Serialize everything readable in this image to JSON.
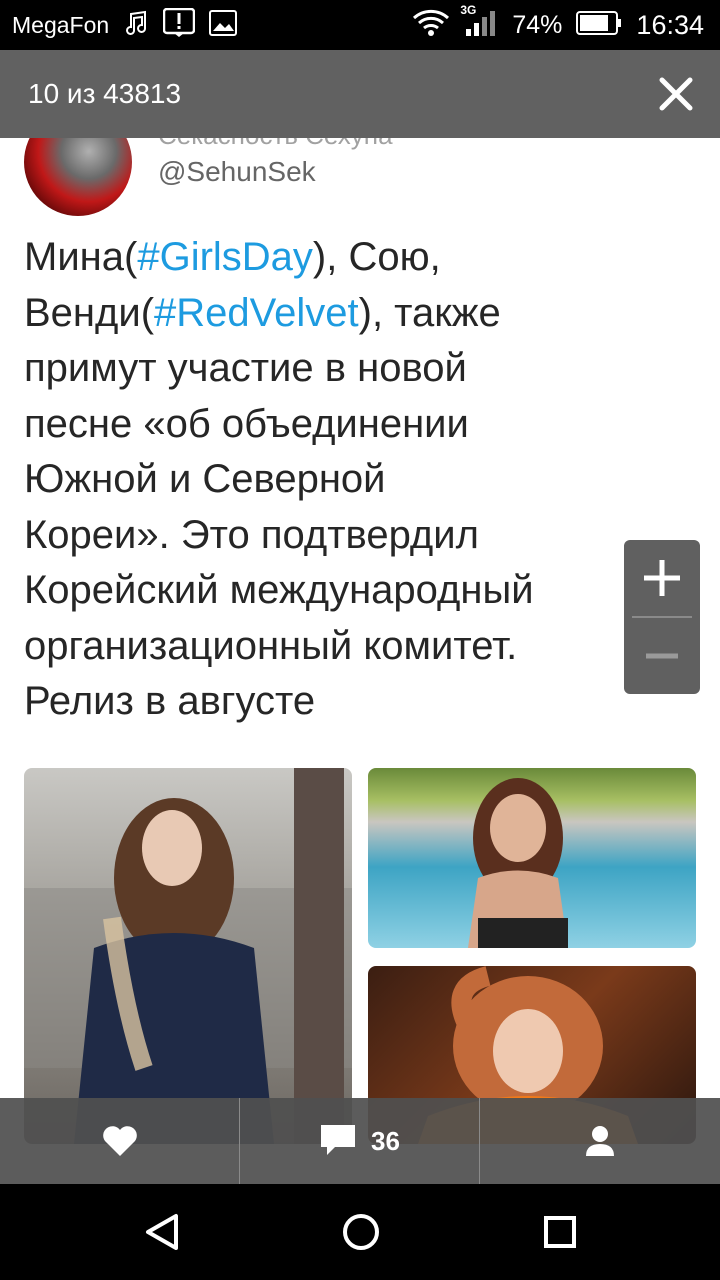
{
  "status_bar": {
    "carrier": "MegaFon",
    "network": "3G",
    "battery": "74%",
    "time": "16:34",
    "icons": [
      "music-note-icon",
      "alert-icon",
      "image-icon",
      "wifi-icon",
      "signal-icon",
      "battery-icon"
    ]
  },
  "viewer": {
    "counter": "10 из 43813",
    "close_icon": "close-icon"
  },
  "post": {
    "handle_top": "Секасность Сехуна",
    "handle": "@SehunSek",
    "text": {
      "l1_a": "Мина(",
      "l1_tag": "#GirlsDay",
      "l1_b": "), Сою,",
      "l2_a": "Венди(",
      "l2_tag": "#RedVelvet",
      "l2_b": "), также",
      "l3": "примут участие в новой",
      "l4": "песне «об объединении",
      "l5": "Южной и Северной",
      "l6": "Кореи». Это подтвердил",
      "l7": "Корейский международный",
      "l8": "организационный комитет.",
      "l9": "Релиз в августе"
    },
    "hashtag_color": "#1d9be0"
  },
  "zoom": {
    "in_icon": "plus-icon",
    "out_icon": "minus-icon"
  },
  "actions": {
    "like_icon": "heart-icon",
    "comment_icon": "comment-icon",
    "comment_count": "36",
    "share_icon": "person-icon"
  },
  "nav": {
    "back_icon": "back-triangle-icon",
    "home_icon": "home-circle-icon",
    "recents_icon": "recents-square-icon"
  }
}
